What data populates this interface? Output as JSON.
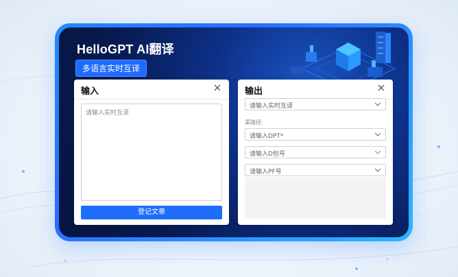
{
  "app": {
    "title": "HelloGPT AI翻译",
    "subtitle": "多语言实时互译"
  },
  "input_panel": {
    "title": "输入",
    "placeholder": "请输入实时互译",
    "button_label": "登记文章"
  },
  "output_panel": {
    "title": "输出",
    "language_select": "请输入实时互译",
    "field_label": "渠路径:",
    "field1": "请输入DPT*",
    "field2": "请输入D包号",
    "field3": "请输入PF号"
  },
  "colors": {
    "accent": "#1e6dfa",
    "frame": "#2d6cff",
    "dark_bg": "#071a4f"
  }
}
